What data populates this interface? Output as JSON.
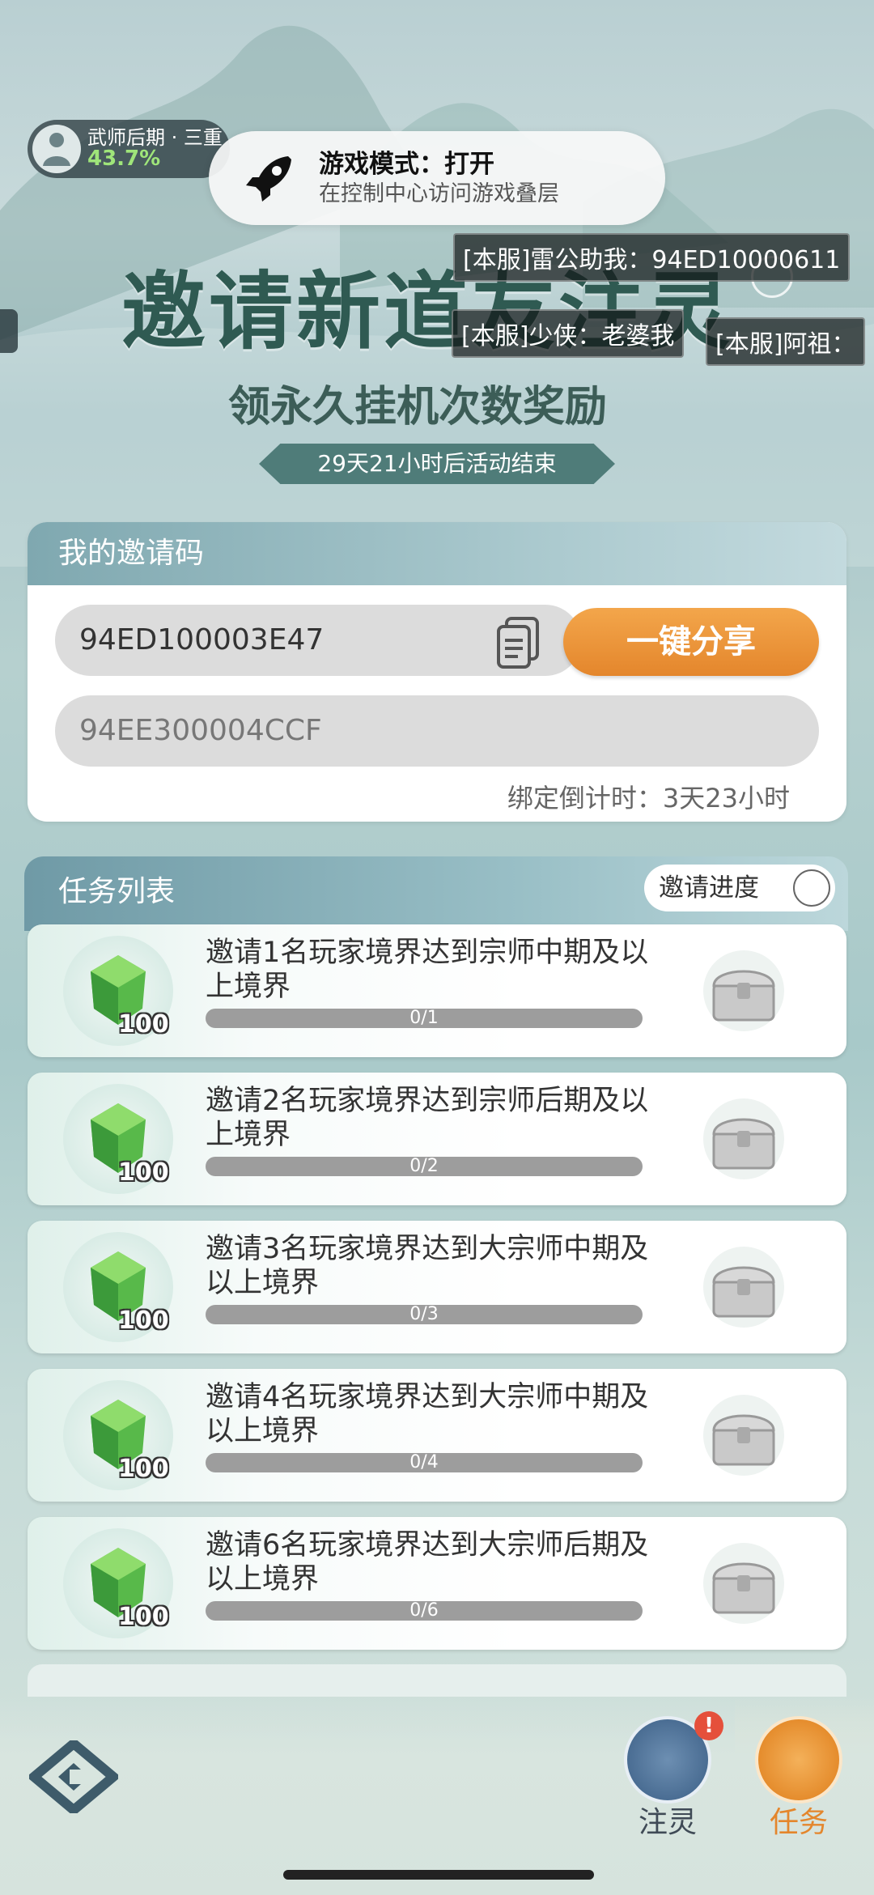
{
  "player": {
    "realm": "武师后期 · 三重",
    "progress": "43.7%"
  },
  "toast": {
    "title": "游戏模式：打开",
    "subtitle": "在控制中心访问游戏叠层",
    "icon": "rocket-icon"
  },
  "danmaku": [
    "[本服]雷公助我：94ED10000611",
    "[本服]少侠：老婆我",
    "[本服]阿祖："
  ],
  "header": {
    "title": "邀请新道友注灵",
    "subtitle": "领永久挂机次数奖励",
    "countdown": "29天21小时后活动结束"
  },
  "invite": {
    "panel_title": "我的邀请码",
    "my_code": "94ED100003E47",
    "share_label": "一键分享",
    "bound_code": "94EE300004CCF",
    "bind_countdown": "绑定倒计时：3天23小时"
  },
  "tasks": {
    "title": "任务列表",
    "progress_button": "邀请进度",
    "items": [
      {
        "desc": "邀请1名玩家境界达到宗师中期及以上境界",
        "reward": "100",
        "progress": "0/1",
        "fraction": 0
      },
      {
        "desc": "邀请2名玩家境界达到宗师后期及以上境界",
        "reward": "100",
        "progress": "0/2",
        "fraction": 0
      },
      {
        "desc": "邀请3名玩家境界达到大宗师中期及以上境界",
        "reward": "100",
        "progress": "0/3",
        "fraction": 0
      },
      {
        "desc": "邀请4名玩家境界达到大宗师中期及以上境界",
        "reward": "100",
        "progress": "0/4",
        "fraction": 0
      },
      {
        "desc": "邀请6名玩家境界达到大宗师后期及以上境界",
        "reward": "100",
        "progress": "0/6",
        "fraction": 0
      }
    ]
  },
  "nav": {
    "zhuling": "注灵",
    "renwu": "任务",
    "alert": "!"
  },
  "colors": {
    "accent": "#e4862c",
    "panel_header": "#7fa8b0",
    "progress_track": "#9d9d9d"
  }
}
